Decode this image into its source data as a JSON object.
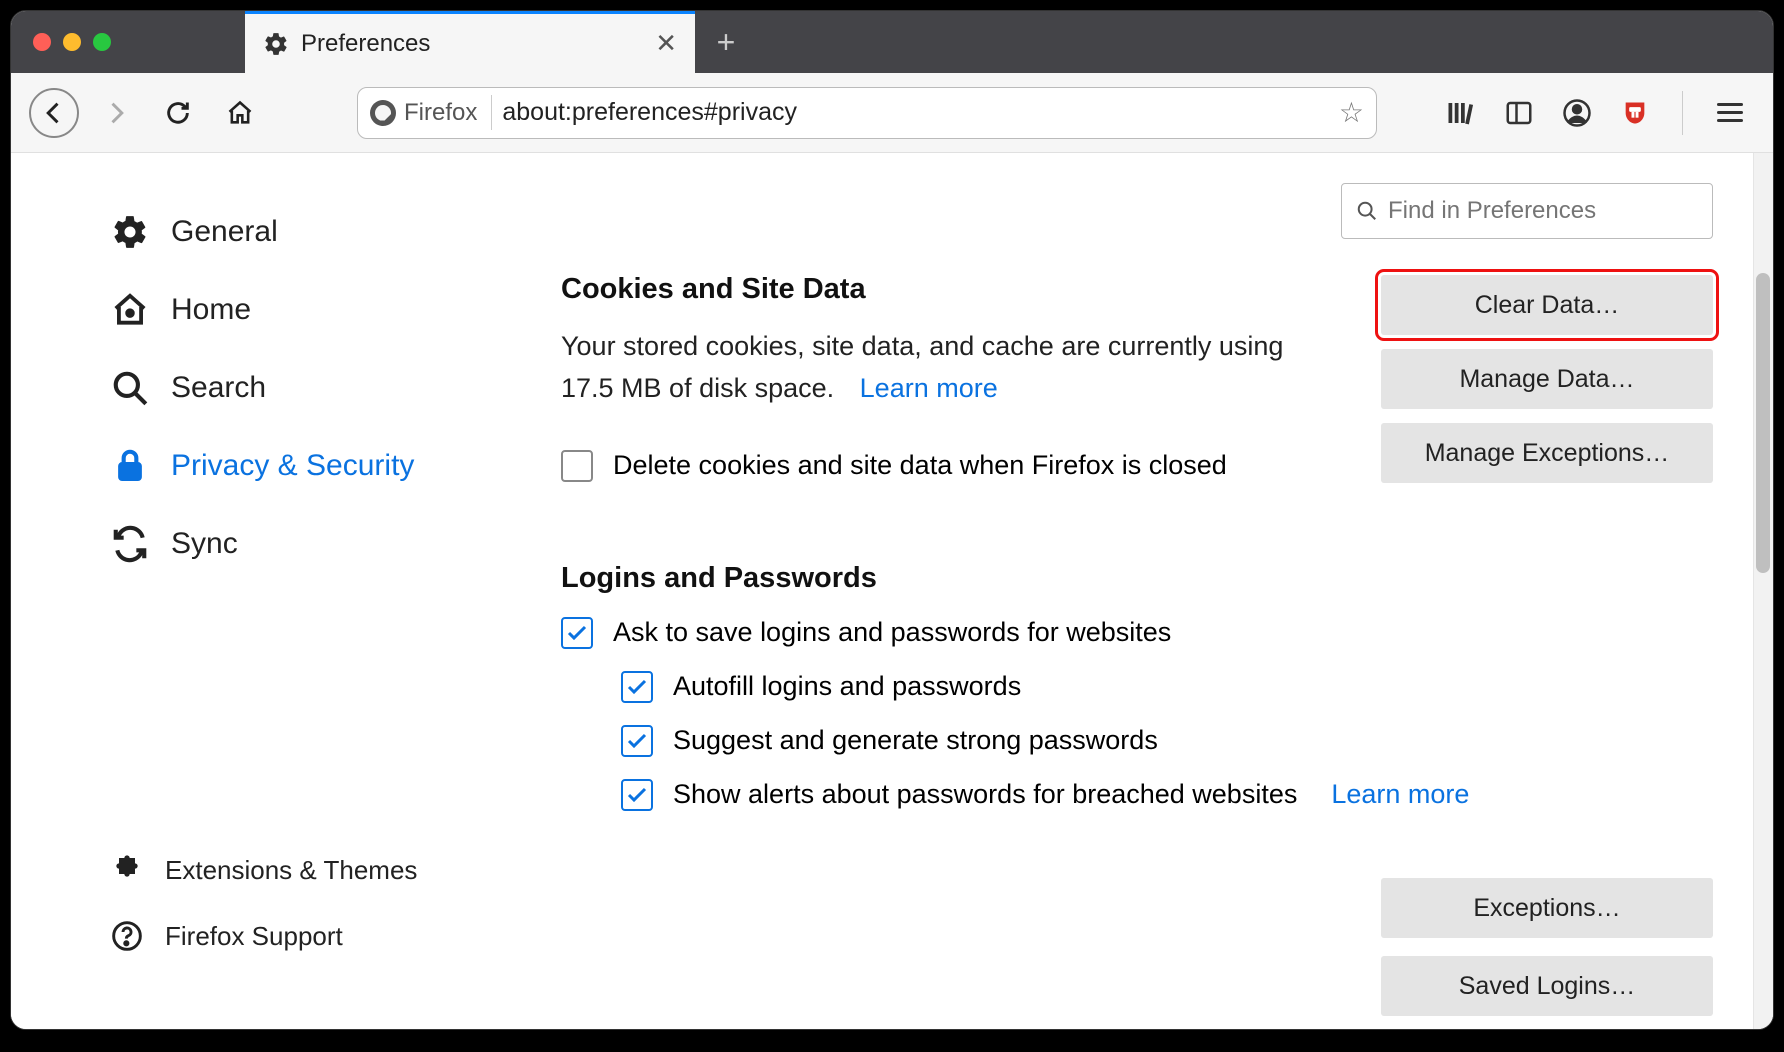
{
  "tab": {
    "title": "Preferences"
  },
  "urlbar": {
    "chip": "Firefox",
    "url": "about:preferences#privacy"
  },
  "search": {
    "placeholder": "Find in Preferences"
  },
  "sidebar": {
    "items": [
      {
        "label": "General"
      },
      {
        "label": "Home"
      },
      {
        "label": "Search"
      },
      {
        "label": "Privacy & Security"
      },
      {
        "label": "Sync"
      }
    ],
    "bottom": [
      {
        "label": "Extensions & Themes"
      },
      {
        "label": "Firefox Support"
      }
    ]
  },
  "cookies": {
    "heading": "Cookies and Site Data",
    "desc": "Your stored cookies, site data, and cache are currently using 17.5 MB of disk space.",
    "learn": "Learn more",
    "delete_on_close": "Delete cookies and site data when Firefox is closed",
    "buttons": {
      "clear": "Clear Data…",
      "manage": "Manage Data…",
      "exceptions": "Manage Exceptions…"
    }
  },
  "logins": {
    "heading": "Logins and Passwords",
    "ask": "Ask to save logins and passwords for websites",
    "autofill": "Autofill logins and passwords",
    "suggest": "Suggest and generate strong passwords",
    "alerts": "Show alerts about passwords for breached websites",
    "learn": "Learn more",
    "buttons": {
      "exceptions": "Exceptions…",
      "saved": "Saved Logins…"
    }
  }
}
